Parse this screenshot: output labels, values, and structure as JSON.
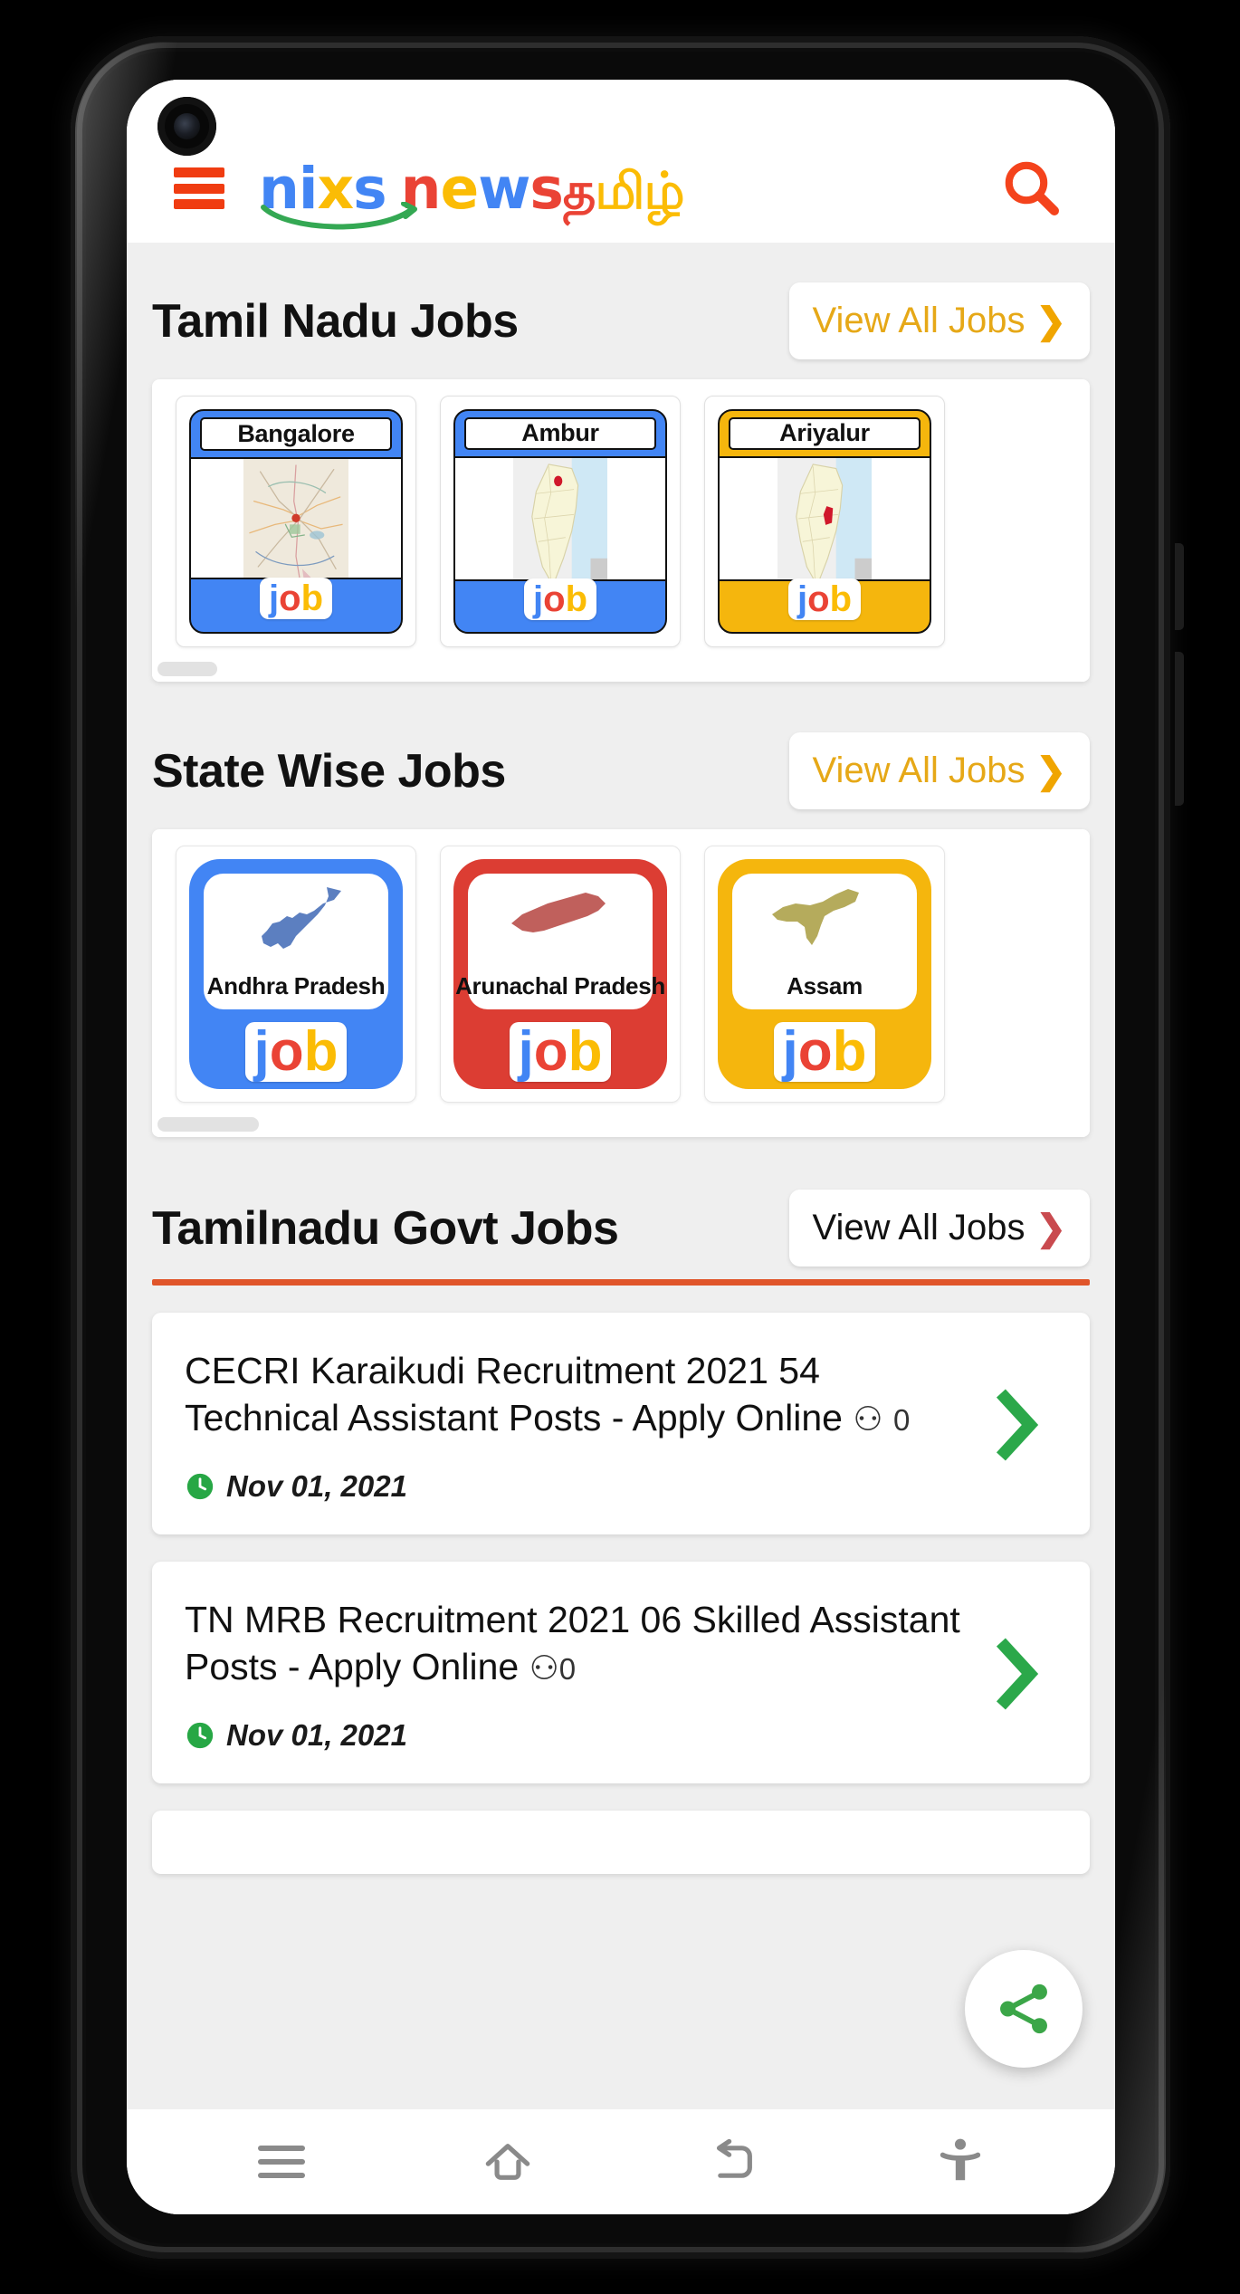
{
  "header": {
    "menu_icon": "hamburger-menu-icon",
    "search_icon": "search-icon",
    "logo": {
      "part1": "nixs",
      "part2": "news",
      "part3": "தமிழ்"
    }
  },
  "sections": {
    "tamil_nadu_jobs": {
      "title": "Tamil Nadu Jobs",
      "view_all_label": "View All Jobs",
      "chevron": "❯",
      "cards": [
        {
          "label": "Bangalore",
          "color": "#4285f4",
          "map": "bangalore-city-map"
        },
        {
          "label": "Ambur",
          "color": "#4285f4",
          "map": "tamil-nadu-district-map"
        },
        {
          "label": "Ariyalur",
          "color": "#f5b60d",
          "map": "tamil-nadu-district-map"
        }
      ]
    },
    "state_wise_jobs": {
      "title": "State Wise Jobs",
      "view_all_label": "View All Jobs",
      "chevron": "❯",
      "cards": [
        {
          "label": "Andhra Pradesh",
          "color": "#4285f4",
          "map_color": "#5c7fc0",
          "map": "andhra-pradesh-state-map"
        },
        {
          "label": "Arunachal Pradesh",
          "color": "#dc3d33",
          "map_color": "#c0605c",
          "map": "arunachal-pradesh-state-map"
        },
        {
          "label": "Assam",
          "color": "#f5b60d",
          "map_color": "#b5ab5c",
          "map": "assam-state-map"
        }
      ]
    },
    "tamilnadu_govt_jobs": {
      "title": "Tamilnadu Govt Jobs",
      "view_all_label": "View All Jobs",
      "chevron": "❯",
      "items": [
        {
          "title": "CECRI Karaikudi Recruitment 2021 54 Technical Assistant Posts - Apply Online",
          "comment_icon": "⚇",
          "comment_count": "0",
          "date": "Nov 01, 2021",
          "clock_icon": "clock-icon",
          "arrow": "❯"
        },
        {
          "title": "TN MRB Recruitment 2021 06 Skilled Assistant Posts - Apply Online",
          "comment_icon": "⚇",
          "comment_count": "0",
          "date": "Nov 01, 2021",
          "clock_icon": "clock-icon",
          "arrow": "❯"
        }
      ]
    }
  },
  "floating": {
    "share_icon": "share-icon",
    "scroll_up_icon": "chevron-up-icon"
  },
  "job_logo": {
    "j": "j",
    "o": "o",
    "b": "b"
  },
  "nav_bar": {
    "recents_icon": "menu-icon",
    "home_icon": "home-icon",
    "back_icon": "back-arrow-icon",
    "accessibility_icon": "accessibility-icon"
  },
  "colors": {
    "accent_orange": "#f03c11",
    "amber": "#e6a817",
    "green": "#3ba648",
    "red_divider": "#e0552a",
    "blue": "#4285f4",
    "page_bg": "#efefef"
  }
}
